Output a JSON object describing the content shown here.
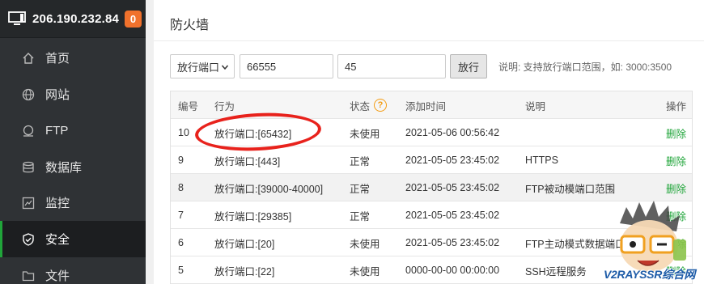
{
  "sidebar": {
    "server_ip": "206.190.232.84",
    "badge_count": "0",
    "items": [
      {
        "label": "首页",
        "icon": "home-icon"
      },
      {
        "label": "网站",
        "icon": "globe-icon"
      },
      {
        "label": "FTP",
        "icon": "ftp-icon"
      },
      {
        "label": "数据库",
        "icon": "database-icon"
      },
      {
        "label": "监控",
        "icon": "monitor-chart-icon"
      },
      {
        "label": "安全",
        "icon": "shield-icon",
        "active": true
      },
      {
        "label": "文件",
        "icon": "folder-icon"
      }
    ]
  },
  "page": {
    "title": "防火墙"
  },
  "form": {
    "type_select": "放行端口",
    "port_value": "66555",
    "remark_value": "45",
    "submit_label": "放行",
    "note": "说明: 支持放行端口范围，如: 3000:3500"
  },
  "table": {
    "headers": [
      "编号",
      "行为",
      "状态",
      "添加时间",
      "说明",
      "操作"
    ],
    "status_help": "?",
    "rows": [
      {
        "id": "10",
        "action": "放行端口:[65432]",
        "status": "未使用",
        "time": "2021-05-06 00:56:42",
        "desc": "",
        "op": "删除"
      },
      {
        "id": "9",
        "action": "放行端口:[443]",
        "status": "正常",
        "time": "2021-05-05 23:45:02",
        "desc": "HTTPS",
        "op": "删除"
      },
      {
        "id": "8",
        "action": "放行端口:[39000-40000]",
        "status": "正常",
        "time": "2021-05-05 23:45:02",
        "desc": "FTP被动模端口范围",
        "op": "删除"
      },
      {
        "id": "7",
        "action": "放行端口:[29385]",
        "status": "正常",
        "time": "2021-05-05 23:45:02",
        "desc": "",
        "op": "删除"
      },
      {
        "id": "6",
        "action": "放行端口:[20]",
        "status": "未使用",
        "time": "2021-05-05 23:45:02",
        "desc": "FTP主动模式数据端口",
        "op": "删除"
      },
      {
        "id": "5",
        "action": "放行端口:[22]",
        "status": "未使用",
        "time": "0000-00-00 00:00:00",
        "desc": "SSH远程服务",
        "op": "删除"
      }
    ]
  },
  "watermark": {
    "text": "V2RAYSSR综合网"
  },
  "colors": {
    "accent_green": "#20a53a",
    "badge_orange": "#f0712c",
    "highlight_red": "#e8221c"
  }
}
